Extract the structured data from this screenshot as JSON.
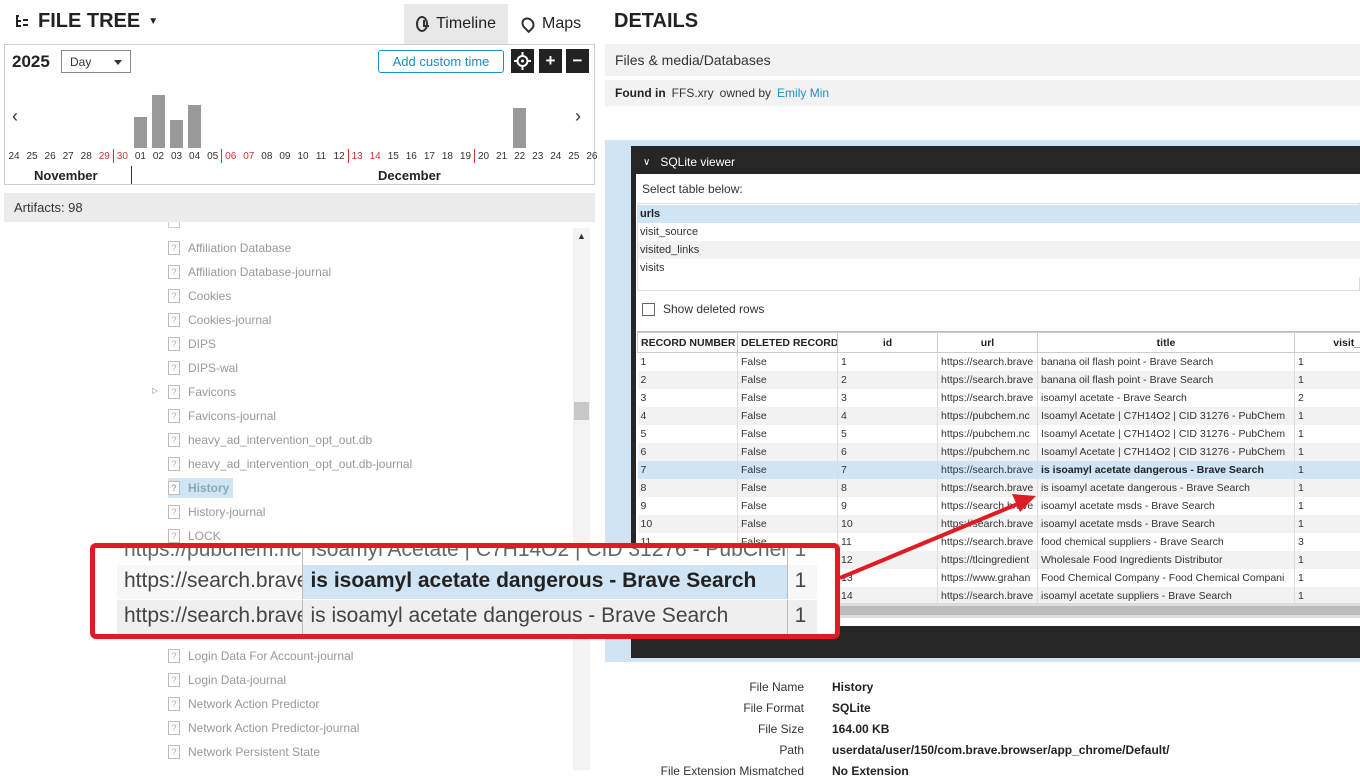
{
  "left": {
    "title": "FILE TREE",
    "tabs": [
      "Timeline",
      "Maps"
    ],
    "timeline": {
      "year": "2025",
      "granularity": "Day",
      "add_custom_time": "Add custom time",
      "zoom_in": "+",
      "zoom_out": "−",
      "day_labels": [
        "24",
        "25",
        "26",
        "27",
        "28",
        "29",
        "30",
        "01",
        "02",
        "03",
        "04",
        "05",
        "06",
        "07",
        "08",
        "09",
        "10",
        "11",
        "12",
        "13",
        "14",
        "15",
        "16",
        "17",
        "18",
        "19",
        "20",
        "21",
        "22",
        "23",
        "24",
        "25",
        "26"
      ],
      "red_days": [
        "29",
        "30",
        "06",
        "07",
        "13",
        "14",
        "20",
        "21"
      ],
      "months": [
        "November",
        "December"
      ],
      "bars": [
        {
          "day": "01",
          "value": 0.55
        },
        {
          "day": "02",
          "value": 0.95
        },
        {
          "day": "03",
          "value": 0.5
        },
        {
          "day": "04",
          "value": 0.77
        },
        {
          "day": "22",
          "value": 0.72
        }
      ]
    },
    "artifacts": "Artifacts: 98",
    "tree": [
      "Affiliation Database",
      "Affiliation Database-journal",
      "Cookies",
      "Cookies-journal",
      "DIPS",
      "DIPS-wal",
      "Favicons",
      "Favicons-journal",
      "heavy_ad_intervention_opt_out.db",
      "heavy_ad_intervention_opt_out.db-journal",
      "History",
      "History-journal",
      "LOCK"
    ],
    "tree_bottom": [
      "Login Data For Account-journal",
      "Login Data-journal",
      "Network Action Predictor",
      "Network Action Predictor-journal",
      "Network Persistent State"
    ]
  },
  "details": {
    "title": "DETAILS",
    "category": "Files & media/Databases",
    "found_in_label": "Found in",
    "found_in_value": "FFS.xry",
    "owned_by_label": "owned by",
    "owner": "Emily Min",
    "viewer_title": "SQLite viewer",
    "select_table_label": "Select table below:",
    "tables": [
      "urls",
      "visit_source",
      "visited_links",
      "visits"
    ],
    "show_deleted": "Show deleted rows",
    "columns": [
      "RECORD NUMBER",
      "DELETED RECORD",
      "id",
      "url",
      "title",
      "visit_cou"
    ],
    "rows": [
      [
        "1",
        "False",
        "1",
        "https://search.brave",
        "banana oil flash point - Brave Search",
        "1"
      ],
      [
        "2",
        "False",
        "2",
        "https://search.brave",
        "banana oil flash point - Brave Search",
        "1"
      ],
      [
        "3",
        "False",
        "3",
        "https://search.brave",
        "isoamyl acetate - Brave Search",
        "2"
      ],
      [
        "4",
        "False",
        "4",
        "https://pubchem.nc",
        "Isoamyl Acetate | C7H14O2 | CID 31276 - PubChem",
        "1"
      ],
      [
        "5",
        "False",
        "5",
        "https://pubchem.nc",
        "Isoamyl Acetate | C7H14O2 | CID 31276 - PubChem",
        "1"
      ],
      [
        "6",
        "False",
        "6",
        "https://pubchem.nc",
        "Isoamyl Acetate | C7H14O2 | CID 31276 - PubChem",
        "1"
      ],
      [
        "7",
        "False",
        "7",
        "https://search.brave",
        "is isoamyl acetate dangerous - Brave Search",
        "1"
      ],
      [
        "8",
        "False",
        "8",
        "https://search.brave",
        "is isoamyl acetate dangerous - Brave Search",
        "1"
      ],
      [
        "9",
        "False",
        "9",
        "https://search.brave",
        "isoamyl acetate msds - Brave Search",
        "1"
      ],
      [
        "10",
        "False",
        "10",
        "https://search.brave",
        "isoamyl acetate msds - Brave Search",
        "1"
      ],
      [
        "11",
        "False",
        "11",
        "https://search.brave",
        "food chemical suppliers - Brave Search",
        "3"
      ],
      [
        "12",
        "False",
        "12",
        "https://tlcingredient",
        "Wholesale Food Ingredients Distributor",
        "1"
      ],
      [
        "13",
        "False",
        "13",
        "https://www.grahan",
        "Food Chemical Company - Food Chemical Compani",
        "1"
      ],
      [
        "14",
        "False",
        "14",
        "https://search.brave",
        "isoamyl acetate suppliers - Brave Search",
        "1"
      ]
    ],
    "file_info": [
      {
        "label": "File Name",
        "value": "History"
      },
      {
        "label": "File Format",
        "value": "SQLite"
      },
      {
        "label": "File Size",
        "value": "164.00 KB"
      },
      {
        "label": "Path",
        "value": "userdata/user/150/com.brave.browser/app_chrome/Default/"
      },
      {
        "label": "File Extension Mismatched",
        "value": "No Extension"
      }
    ]
  },
  "zoom": {
    "row_partial": [
      "https://pubchem.nc",
      "Isoamyl Acetate | C7H14O2 | CID 31276 - PubChem",
      "1"
    ],
    "row_highlight": [
      "https://search.brave",
      "is isoamyl acetate dangerous - Brave Search",
      "1"
    ],
    "row_next": [
      "https://search.brave",
      "is isoamyl acetate dangerous - Brave Search",
      "1"
    ]
  },
  "colors": {
    "accent": "#1a8fc2",
    "highlight": "#cfe4f4",
    "callout": "#e01b24",
    "weekend": "#cc3333"
  }
}
